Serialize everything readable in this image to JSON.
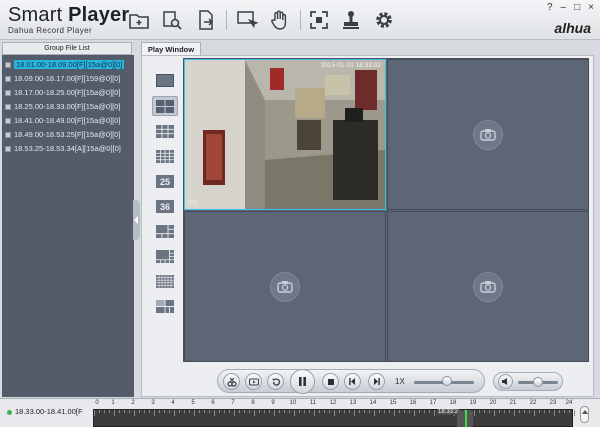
{
  "app": {
    "title_light": "Smart ",
    "title_bold": "Player",
    "subtitle": "Dahua Record Player",
    "logo": "alhua"
  },
  "window_controls": [
    "?",
    "–",
    "□",
    "×"
  ],
  "toolbar_icons": [
    "add-folder-icon",
    "search-file-icon",
    "export-file-icon",
    "snapshot-icon",
    "hand-drag-icon",
    "fullscreen-icon",
    "stamp-icon",
    "settings-gear-icon"
  ],
  "left_panel": {
    "tab": "Group File List",
    "files": [
      {
        "label": "18.01.00-18.09.00[F][15a@0][0]",
        "selected": true
      },
      {
        "label": "18.09.00-18.17.00[F][159@0][0]",
        "selected": false
      },
      {
        "label": "18.17.00-18.25.00[F][15a@0][0]",
        "selected": false
      },
      {
        "label": "18.25.00-18.33.00[F][15a@0][0]",
        "selected": false
      },
      {
        "label": "18.41.00-18.49.00[F][15a@0][0]",
        "selected": false
      },
      {
        "label": "18.49.00-18.53.25[F][15a@0][0]",
        "selected": false
      },
      {
        "label": "18.53.25-18.53.34[A][15a@0][0]",
        "selected": false
      }
    ]
  },
  "play_window": {
    "tab": "Play Window",
    "layouts": [
      "1",
      "4",
      "9",
      "16",
      "25",
      "36",
      "1+5",
      "1+7",
      "64",
      "custom"
    ],
    "active_layout": 1,
    "video": {
      "timestamp": "2015-01-01 18:33:02",
      "channel_label": "IPC"
    }
  },
  "playback": {
    "speed": "1X",
    "speed_level": 0.55,
    "volume_level": 0.5
  },
  "timeline": {
    "file": "18.33.00-18.41.00[F",
    "hours": [
      "0",
      "1",
      "2",
      "3",
      "4",
      "5",
      "6",
      "7",
      "8",
      "9",
      "10",
      "11",
      "12",
      "13",
      "14",
      "15",
      "16",
      "17",
      "18",
      "19",
      "20",
      "21",
      "22",
      "23",
      "24"
    ],
    "cursor_label": "18:33:2",
    "cursor_hour": 18.55
  }
}
